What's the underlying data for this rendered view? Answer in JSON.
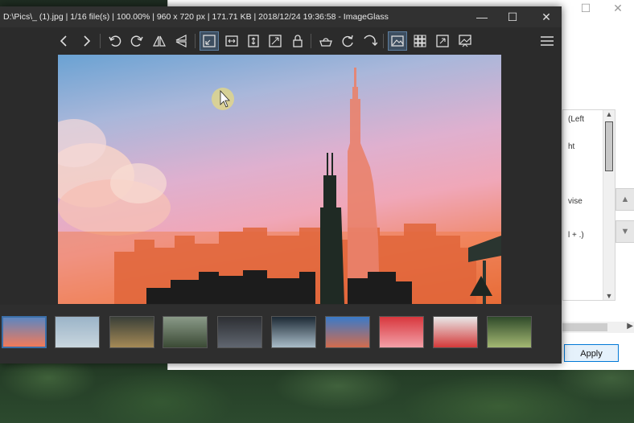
{
  "window": {
    "title": "D:\\Pics\\_ (1).jpg  |  1/16 file(s)  |  100.00%  |  960 x 720 px  |  171.71 KB  |  2018/12/24 19:36:58  -  ImageGlass",
    "controls": {
      "minimize": "—",
      "maximize": "☐",
      "close": "✕"
    }
  },
  "background_dialog": {
    "controls": {
      "maximize": "☐",
      "close": "✕"
    },
    "list_lines": [
      "(Left",
      "ht",
      "vise",
      "l + .)"
    ],
    "apply_label": "Apply"
  },
  "toolbar": {
    "buttons": [
      {
        "name": "previous-image",
        "icon": "chevron-left-icon"
      },
      {
        "name": "next-image",
        "icon": "chevron-right-icon"
      },
      {
        "name": "rotate-left",
        "icon": "rotate-left-icon"
      },
      {
        "name": "rotate-right",
        "icon": "rotate-right-icon"
      },
      {
        "name": "flip-horizontal",
        "icon": "flip-horizontal-icon"
      },
      {
        "name": "flip-vertical",
        "icon": "flip-vertical-icon"
      },
      {
        "name": "auto-zoom",
        "icon": "auto-zoom-icon",
        "active": true
      },
      {
        "name": "scale-to-width",
        "icon": "scale-width-icon"
      },
      {
        "name": "scale-to-height",
        "icon": "scale-height-icon"
      },
      {
        "name": "scale-to-fit",
        "icon": "scale-fit-icon"
      },
      {
        "name": "lock-zoom",
        "icon": "lock-icon"
      },
      {
        "name": "open-with",
        "icon": "open-with-icon"
      },
      {
        "name": "refresh",
        "icon": "refresh-icon"
      },
      {
        "name": "goto",
        "icon": "goto-icon"
      },
      {
        "name": "thumbnail-bar",
        "icon": "thumbnail-bar-icon",
        "active": true
      },
      {
        "name": "checkerboard",
        "icon": "grid-icon"
      },
      {
        "name": "fullscreen",
        "icon": "fullscreen-icon"
      },
      {
        "name": "slideshow",
        "icon": "slideshow-icon"
      },
      {
        "name": "main-menu",
        "icon": "hamburger-menu-icon"
      }
    ]
  },
  "thumbnails": [
    {
      "name": "thumb-1",
      "colors": [
        "#5e86c0",
        "#f07a5a"
      ],
      "selected": true
    },
    {
      "name": "thumb-2",
      "colors": [
        "#9bb4c8",
        "#c9d6de"
      ]
    },
    {
      "name": "thumb-3",
      "colors": [
        "#3a3f38",
        "#a58a56"
      ]
    },
    {
      "name": "thumb-4",
      "colors": [
        "#8a9a88",
        "#3b4a35"
      ]
    },
    {
      "name": "thumb-5",
      "colors": [
        "#2d2f33",
        "#606670"
      ]
    },
    {
      "name": "thumb-6",
      "colors": [
        "#1d2a35",
        "#a9bcc8"
      ]
    },
    {
      "name": "thumb-7",
      "colors": [
        "#3a7ac8",
        "#d26c4d"
      ]
    },
    {
      "name": "thumb-8",
      "colors": [
        "#d8373d",
        "#f3a0a8"
      ]
    },
    {
      "name": "thumb-9",
      "colors": [
        "#e8e8e8",
        "#d43a3a"
      ]
    },
    {
      "name": "thumb-10",
      "colors": [
        "#2f4a2a",
        "#a4b873"
      ]
    }
  ],
  "colors": {
    "window_bg": "#2b2b2b",
    "active_toggle": "#3d4e60",
    "apply_border": "#0078d7"
  }
}
